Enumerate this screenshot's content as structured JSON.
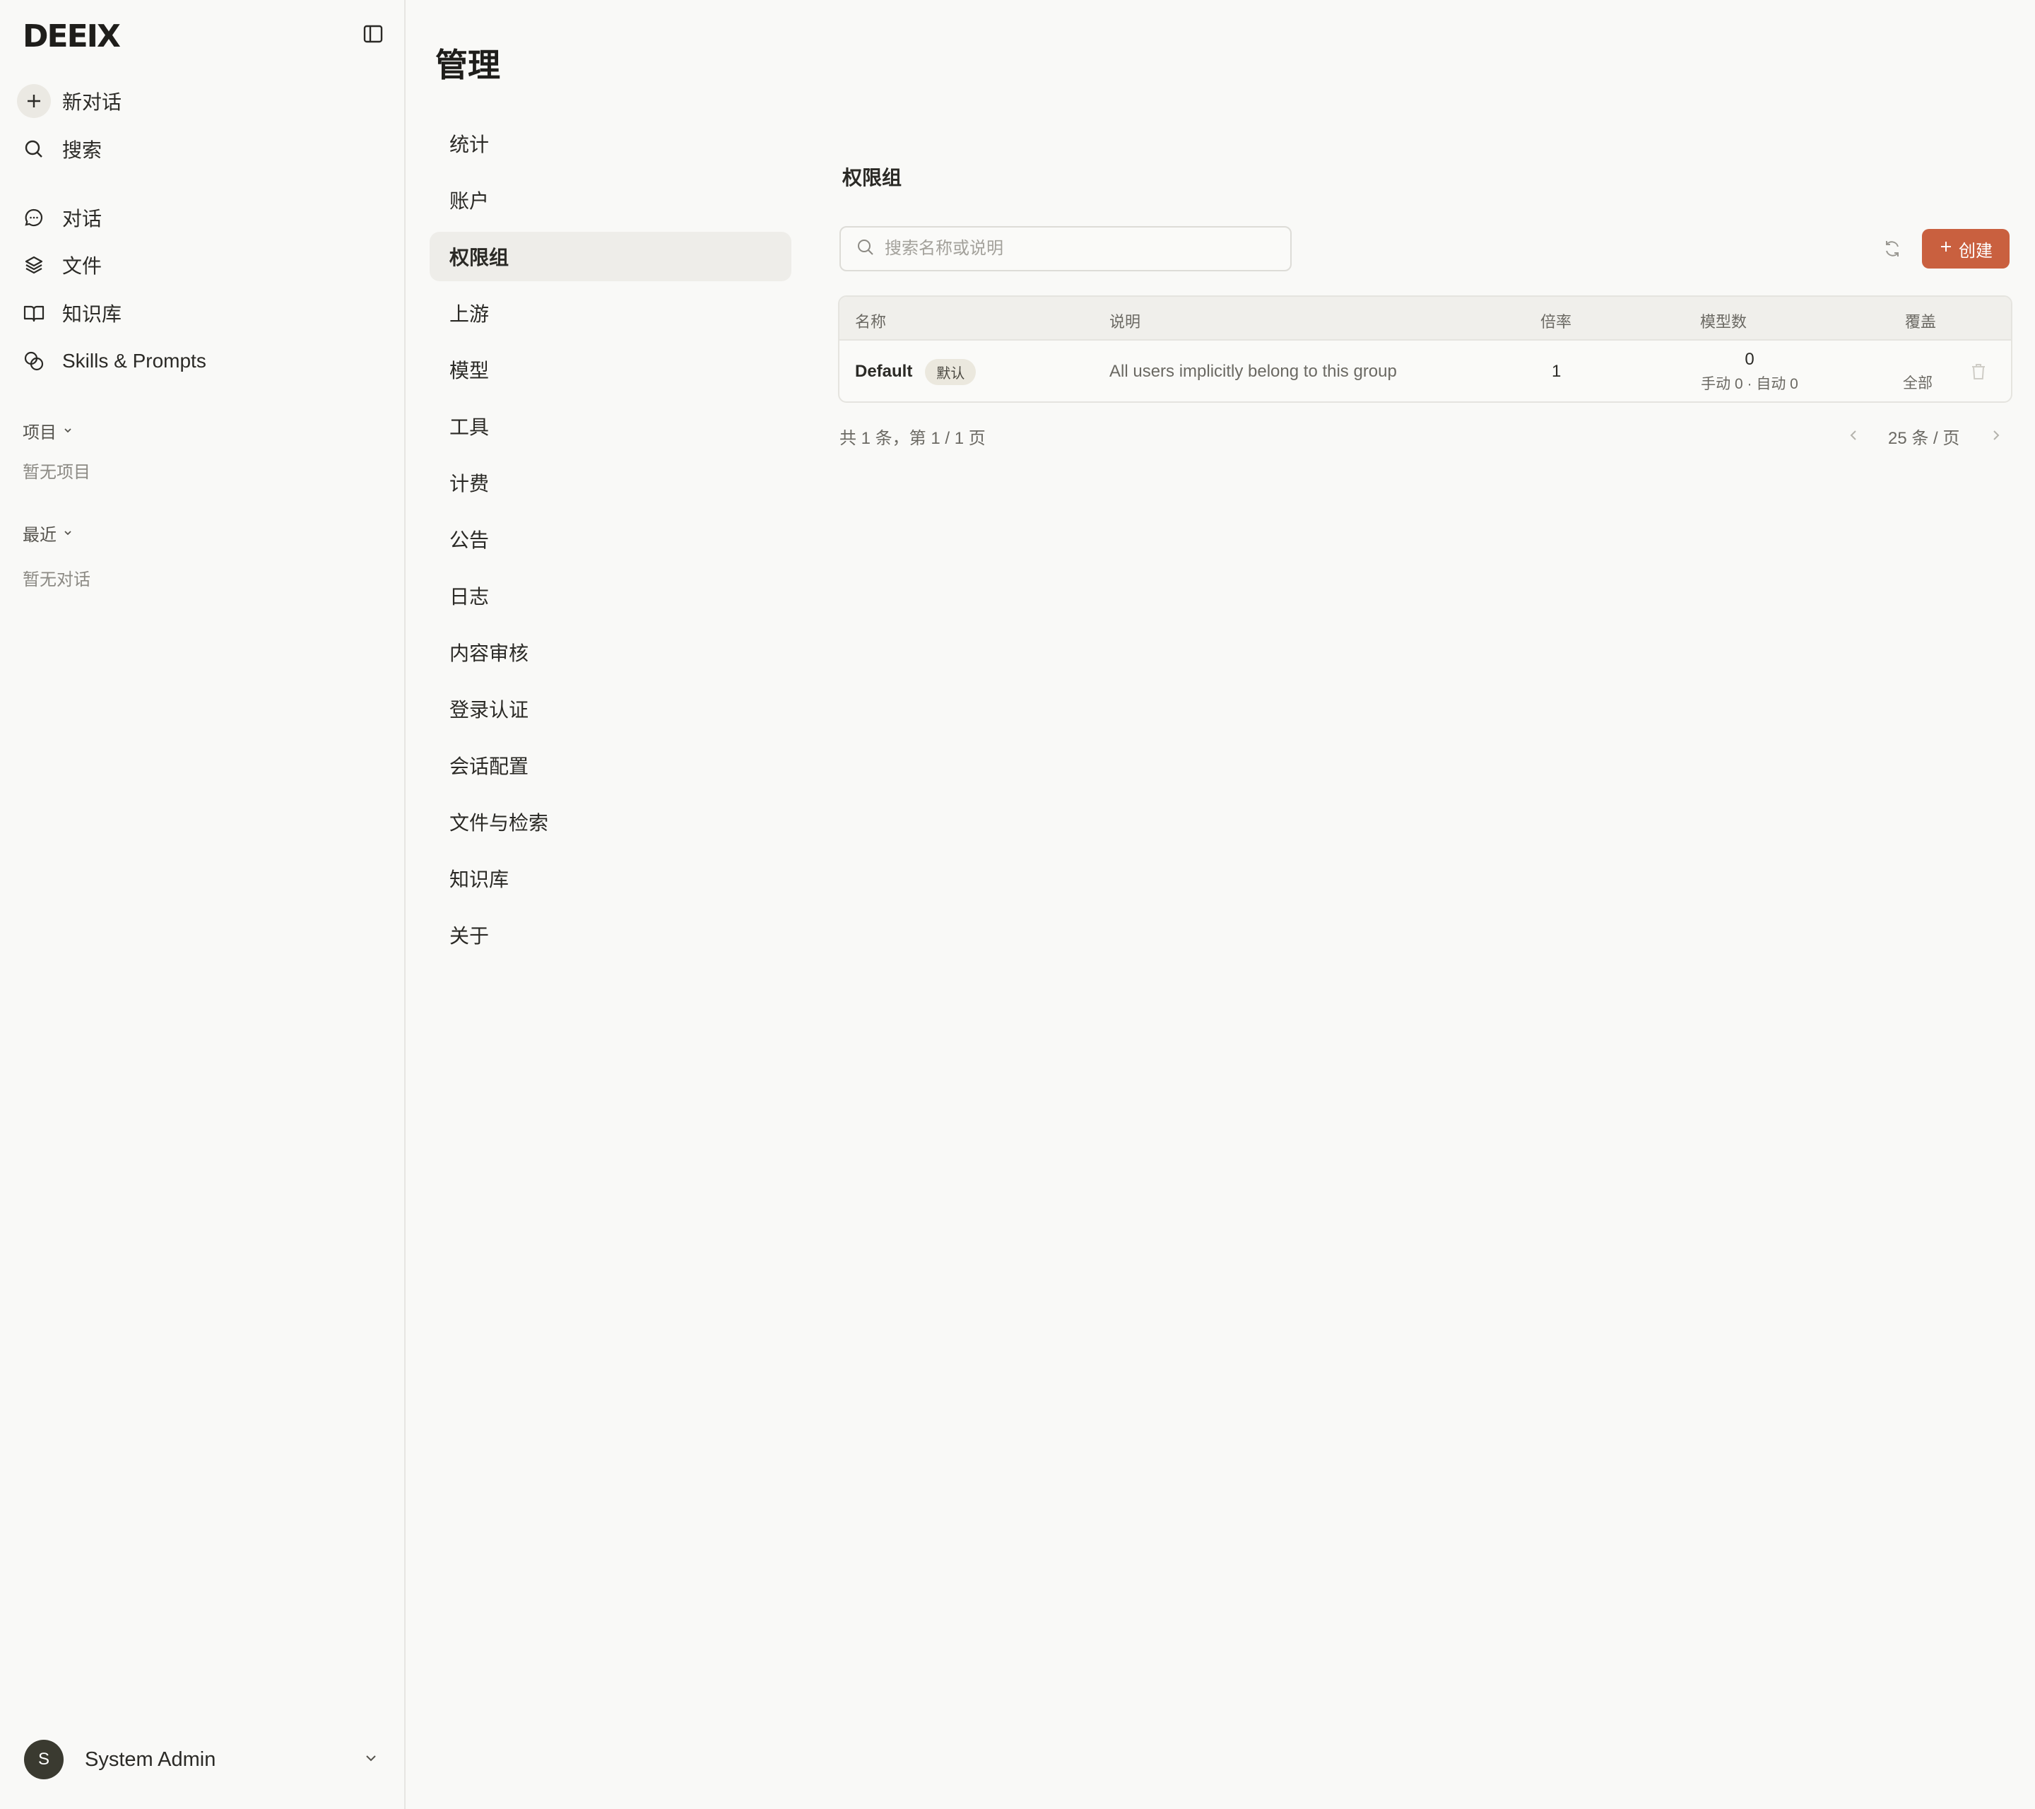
{
  "sidebar": {
    "logo": "DEEIX",
    "new_chat": "新对话",
    "search": "搜索",
    "nav": [
      {
        "label": "对话",
        "icon": "chat-icon"
      },
      {
        "label": "文件",
        "icon": "layers-icon"
      },
      {
        "label": "知识库",
        "icon": "book-icon"
      },
      {
        "label": "Skills & Prompts",
        "icon": "skills-icon"
      }
    ],
    "projects_label": "项目",
    "projects_empty": "暂无项目",
    "recent_label": "最近",
    "recent_empty": "暂无对话",
    "user": {
      "initial": "S",
      "name": "System Admin"
    }
  },
  "admin": {
    "title": "管理",
    "nav": [
      "统计",
      "账户",
      "权限组",
      "上游",
      "模型",
      "工具",
      "计费",
      "公告",
      "日志",
      "内容审核",
      "登录认证",
      "会话配置",
      "文件与检索",
      "知识库",
      "关于"
    ],
    "active_index": 2
  },
  "content": {
    "title": "权限组",
    "search_placeholder": "搜索名称或说明",
    "create_label": "创建",
    "table": {
      "headers": {
        "name": "名称",
        "desc": "说明",
        "rate": "倍率",
        "models": "模型数",
        "cover": "覆盖"
      },
      "rows": [
        {
          "name": "Default",
          "badge": "默认",
          "desc": "All users implicitly belong to this group",
          "rate": "1",
          "models": "0",
          "models_detail": "手动 0 · 自动 0",
          "cover": "全部"
        }
      ]
    },
    "pager": {
      "summary": "共 1 条，第 1 / 1 页",
      "page_size": "25 条 / 页"
    }
  },
  "colors": {
    "accent": "#c9603f",
    "sidebar_bg": "#f9f9f7",
    "active_bg": "#eeede9"
  }
}
